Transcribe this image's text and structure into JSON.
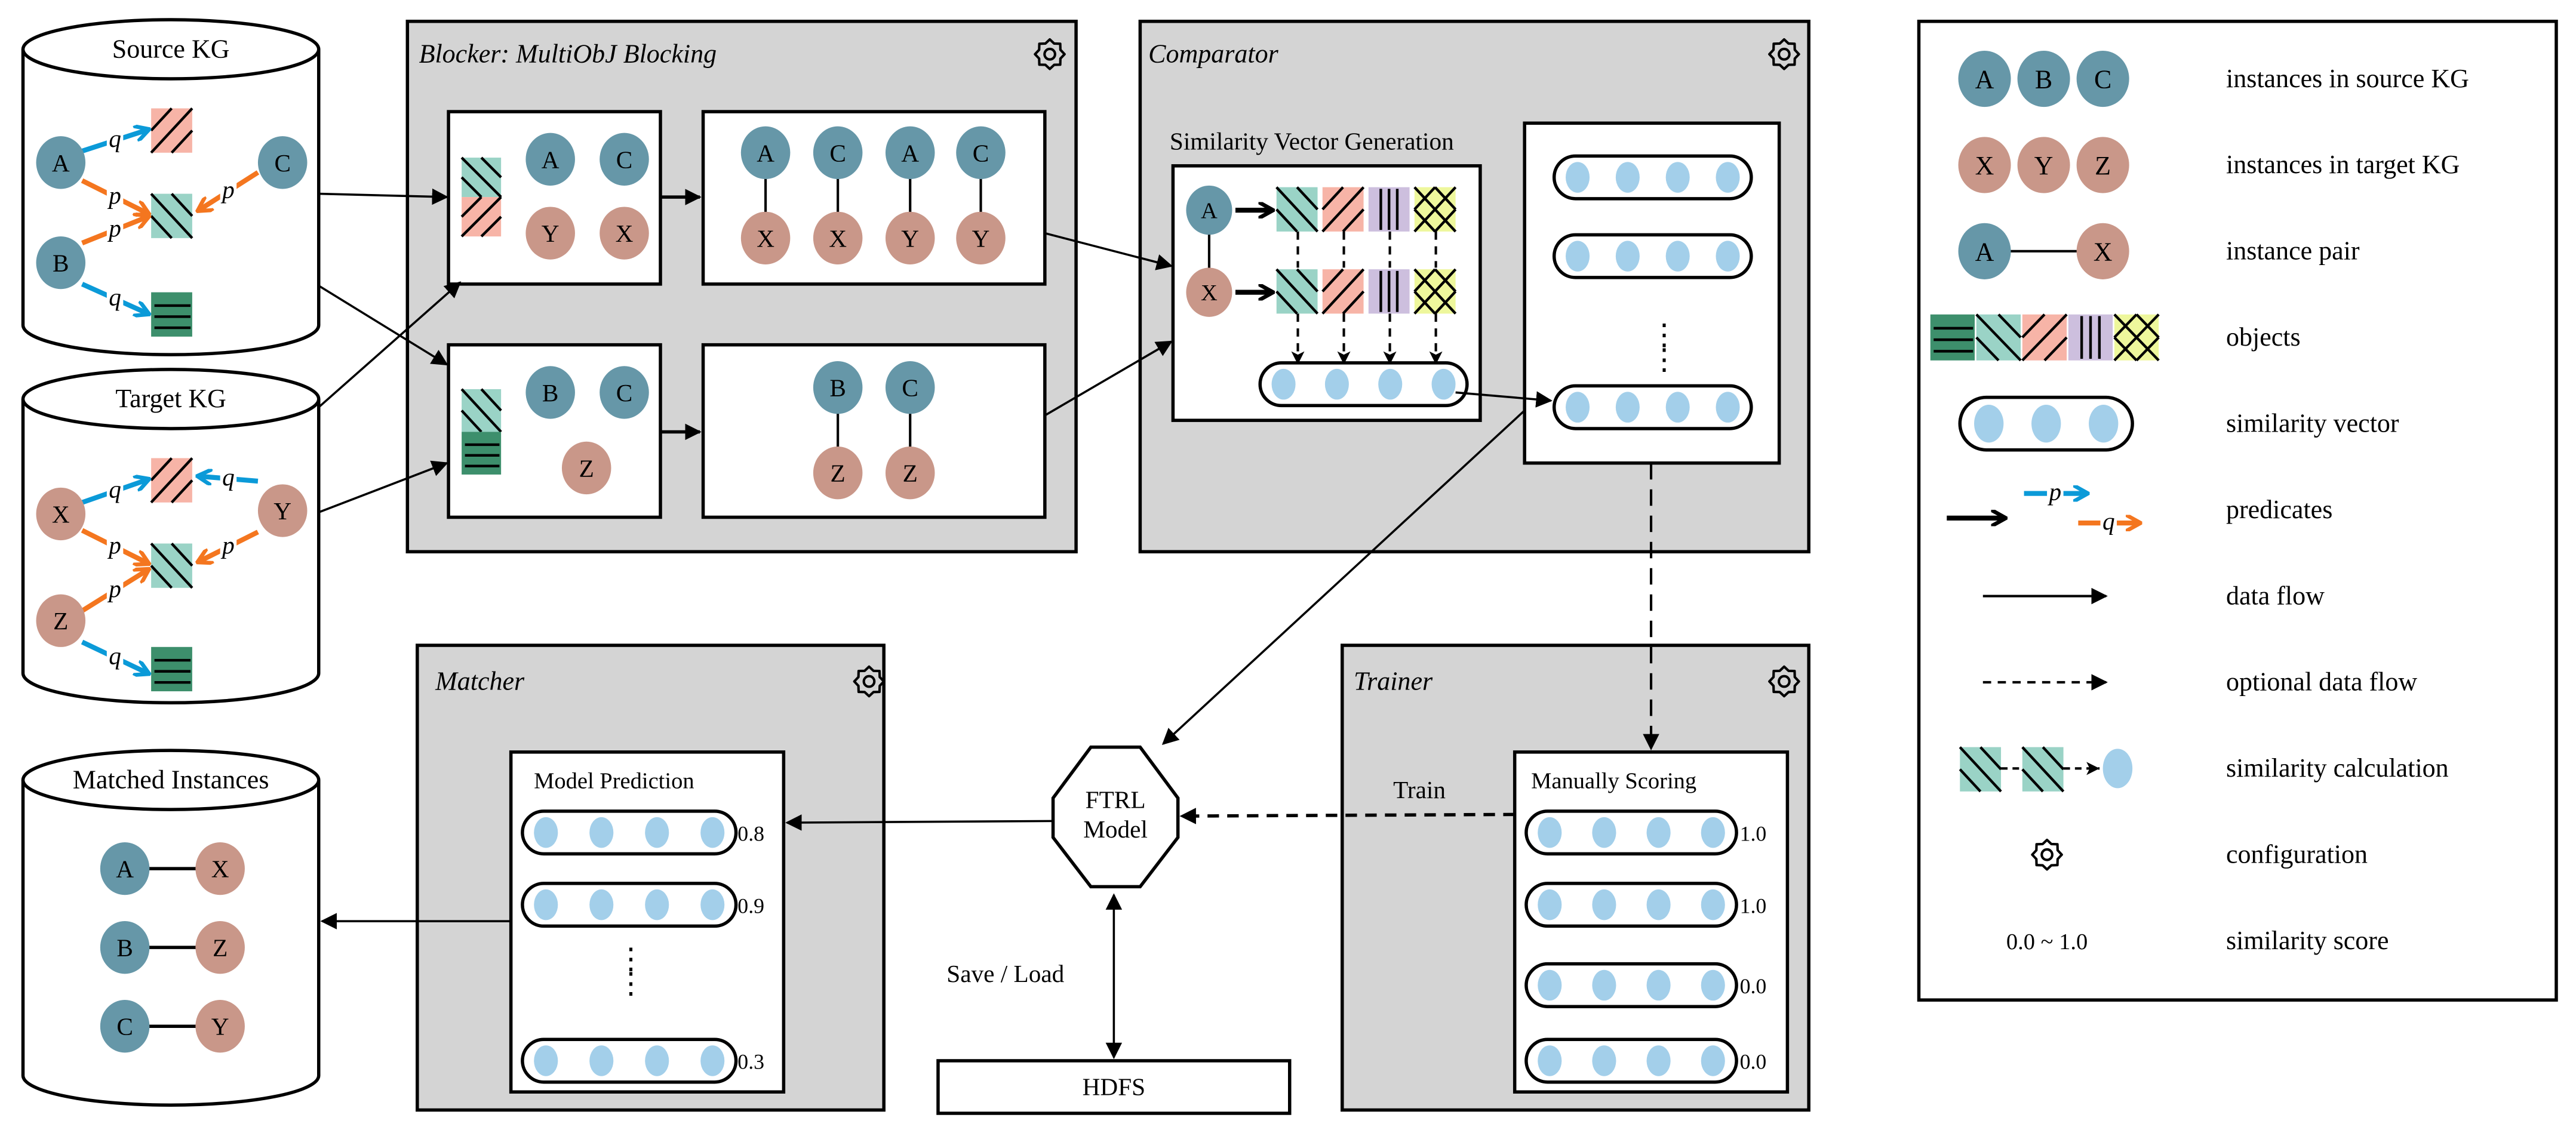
{
  "colors": {
    "source_node": "#6697a8",
    "target_node": "#c99789",
    "vector_dot": "#a3cfea",
    "panel_bg": "#d4d4d4",
    "pred_p": "#f4761f",
    "pred_q": "#0b9ad8",
    "obj_green": "#3d8f6c",
    "obj_teal": "#9ad3c6",
    "obj_pink": "#f7b4a7",
    "obj_purple": "#cdbfde",
    "obj_yellow": "#eef79c"
  },
  "source_kg": {
    "title": "Source KG",
    "nodes": [
      "A",
      "B",
      "C"
    ],
    "edge_labels": {
      "a_q": "q",
      "a_p": "p",
      "b_p": "p",
      "b_q": "q",
      "c_p": "p"
    }
  },
  "target_kg": {
    "title": "Target KG",
    "nodes": [
      "X",
      "Y",
      "Z"
    ],
    "edge_labels": {
      "x_q": "q",
      "x_p": "p",
      "y_q": "q",
      "y_p": "p",
      "z_p": "p",
      "z_q": "q"
    }
  },
  "blocker": {
    "title": "Blocker: MultiObJ Blocking",
    "block1": {
      "source": [
        "A",
        "C"
      ],
      "target": [
        "Y",
        "X"
      ]
    },
    "pairs1": [
      [
        "A",
        "X"
      ],
      [
        "C",
        "X"
      ],
      [
        "A",
        "Y"
      ],
      [
        "C",
        "Y"
      ]
    ],
    "block2": {
      "source": [
        "B",
        "C"
      ],
      "target": [
        "Z"
      ]
    },
    "pairs2": [
      [
        "B",
        "Z"
      ],
      [
        "C",
        "Z"
      ]
    ]
  },
  "comparator": {
    "title": "Comparator",
    "svg_title": "Similarity Vector Generation",
    "pair": [
      "A",
      "X"
    ],
    "ellipsis": "⋮"
  },
  "matcher": {
    "title": "Matcher",
    "box_title": "Model Prediction",
    "scores": [
      "0.8",
      "0.9",
      "0.3"
    ]
  },
  "trainer": {
    "title": "Trainer",
    "box_title": "Manually Scoring",
    "scores": [
      "1.0",
      "1.0",
      "0.0",
      "0.0"
    ],
    "train_label": "Train"
  },
  "model": {
    "line1": "FTRL",
    "line2": "Model"
  },
  "save_load": "Save / Load",
  "hdfs": "HDFS",
  "matched": {
    "title": "Matched Instances",
    "pairs": [
      [
        "A",
        "X"
      ],
      [
        "B",
        "Z"
      ],
      [
        "C",
        "Y"
      ]
    ]
  },
  "legend": {
    "items": [
      {
        "label": "instances in source KG",
        "nodes": [
          "A",
          "B",
          "C"
        ]
      },
      {
        "label": "instances in target KG",
        "nodes": [
          "X",
          "Y",
          "Z"
        ]
      },
      {
        "label": "instance pair",
        "nodes": [
          "A",
          "X"
        ]
      },
      {
        "label": "objects"
      },
      {
        "label": "similarity vector"
      },
      {
        "label": "predicates",
        "p": "p",
        "q": "q"
      },
      {
        "label": "data flow"
      },
      {
        "label": "optional data flow"
      },
      {
        "label": "similarity calculation"
      },
      {
        "label": "configuration"
      },
      {
        "label": "similarity score",
        "sample": "0.0 ~ 1.0"
      }
    ]
  }
}
